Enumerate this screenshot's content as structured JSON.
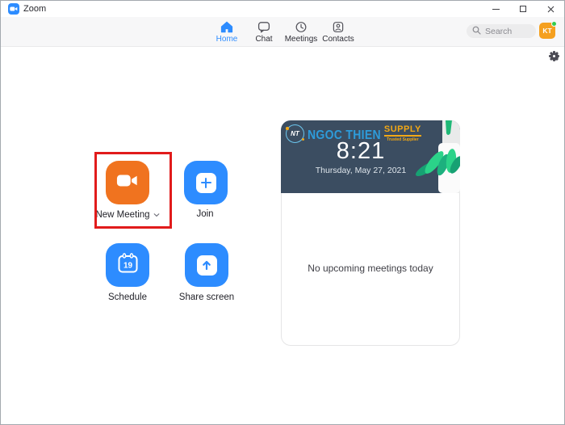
{
  "window": {
    "title": "Zoom",
    "controls": [
      "minimize-icon",
      "maximize-icon",
      "close-icon"
    ]
  },
  "nav": {
    "tabs": [
      {
        "label": "Home",
        "active": true
      },
      {
        "label": "Chat",
        "active": false
      },
      {
        "label": "Meetings",
        "active": false
      },
      {
        "label": "Contacts",
        "active": false
      }
    ],
    "search_placeholder": "Search",
    "avatar_initials": "KT"
  },
  "actions": [
    {
      "label": "New Meeting",
      "icon": "video-camera-icon",
      "has_dropdown": true,
      "highlighted": true
    },
    {
      "label": "Join",
      "icon": "plus-icon"
    },
    {
      "label": "Schedule",
      "icon": "calendar-icon",
      "calendar_day": "19"
    },
    {
      "label": "Share screen",
      "icon": "arrow-up-icon"
    }
  ],
  "panel": {
    "banner": {
      "logo_monogram": "NT",
      "logo_name": "NGOC THIEN",
      "logo_word": "SUPPLY",
      "logo_tagline": "Trusted Supplier",
      "time": "8:21",
      "date": "Thursday, May 27, 2021"
    },
    "empty_state": "No upcoming meetings today"
  },
  "icons": {
    "app_logo": "video-camera-icon",
    "settings": "gear-icon",
    "search": "magnifier-icon",
    "dropdown": "chevron-down-icon"
  },
  "colors": {
    "accent_blue": "#2D8CFF",
    "action_orange": "#F0731F",
    "highlight_red": "#E11B1B",
    "banner_bg": "#3B4D61",
    "logo_blue": "#2D9CDB",
    "logo_orange": "#F2A815",
    "avatar_bg": "#F5A01F",
    "status_green": "#33CC4D"
  }
}
